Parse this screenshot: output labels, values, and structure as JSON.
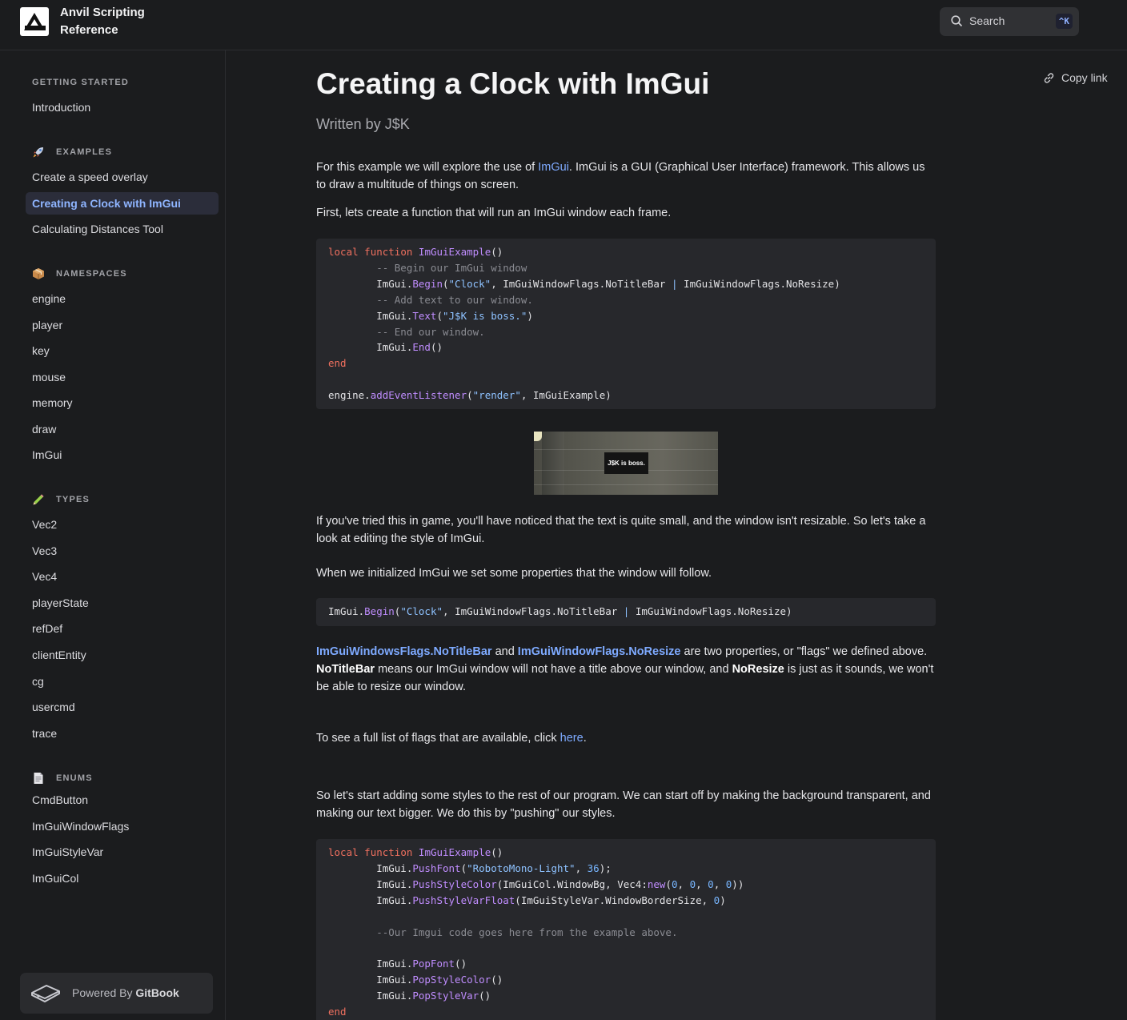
{
  "header": {
    "site_title": "Anvil Scripting Reference",
    "search_placeholder": "Search",
    "search_shortcut": "^K"
  },
  "sidebar": {
    "sections": [
      {
        "title": "GETTING STARTED",
        "icon": "",
        "items": [
          "Introduction"
        ]
      },
      {
        "title": "EXAMPLES",
        "icon": "rocket-icon",
        "items": [
          "Create a speed overlay",
          "Creating a Clock with ImGui",
          "Calculating Distances Tool"
        ]
      },
      {
        "title": "NAMESPACES",
        "icon": "package-icon",
        "items": [
          "engine",
          "player",
          "key",
          "mouse",
          "memory",
          "draw",
          "ImGui"
        ]
      },
      {
        "title": "TYPES",
        "icon": "pencil-icon",
        "items": [
          "Vec2",
          "Vec3",
          "Vec4",
          "playerState",
          "refDef",
          "clientEntity",
          "cg",
          "usercmd",
          "trace"
        ]
      },
      {
        "title": "ENUMS",
        "icon": "document-icon",
        "items": [
          "CmdButton",
          "ImGuiWindowFlags",
          "ImGuiStyleVar",
          "ImGuiCol"
        ]
      }
    ],
    "active_item": "Creating a Clock with ImGui",
    "powered_prefix": "Powered By",
    "powered_brand": "GitBook"
  },
  "page": {
    "title": "Creating a Clock with ImGui",
    "author": "Written by J$K",
    "copy_link": "Copy link",
    "p1_a": "For this example we will explore the use of ",
    "p1_link": "ImGui",
    "p1_b": ". ImGui is a GUI (Graphical User Interface) framework. This allows us to draw a multitude of things on screen.",
    "p2": "First, lets create a function that will run an ImGui window each frame.",
    "image_text": "J$K is boss.",
    "p3": "If you've tried this in game, you'll have noticed that the text is quite small, and the window isn't resizable. So let's take a look at editing the style of ImGui.",
    "p4": "When we initialized ImGui we set some properties that the window will follow.",
    "p5_link1": "ImGuiWindowsFlags.NoTitleBar",
    "p5_a": " and ",
    "p5_link2": "ImGuiWindowFlags.NoResize",
    "p5_b": " are two properties, or \"flags\" we defined above. ",
    "p5_bold1": "NoTitleBar",
    "p5_c": " means our ImGui window will not have a title above our window, and ",
    "p5_bold2": "NoResize",
    "p5_d": " is just as it sounds, we won't be able to resize our window.",
    "p6_a": "To see a full list of flags that are available, click ",
    "p6_link": "here",
    "p6_b": ".",
    "p7": "So let's start adding some styles to the rest of our program. We can start off by making the background transparent, and making our text bigger. We do this by \"pushing\" our styles."
  },
  "code_blocks": [
    {
      "lines": [
        "local function ImGuiExample()",
        "        -- Begin our ImGui window",
        "        ImGui.Begin(\"Clock\", ImGuiWindowFlags.NoTitleBar | ImGuiWindowFlags.NoResize)",
        "        -- Add text to our window.",
        "        ImGui.Text(\"J$K is boss.\")",
        "        -- End our window.",
        "        ImGui.End()",
        "end",
        "",
        "engine.addEventListener(\"render\", ImGuiExample)"
      ]
    },
    {
      "lines": [
        "ImGui.Begin(\"Clock\", ImGuiWindowFlags.NoTitleBar | ImGuiWindowFlags.NoResize)"
      ]
    },
    {
      "lines": [
        "local function ImGuiExample()",
        "        ImGui.PushFont(\"RobotoMono-Light\", 36);",
        "        ImGui.PushStyleColor(ImGuiCol.WindowBg, Vec4:new(0, 0, 0, 0))",
        "        ImGui.PushStyleVarFloat(ImGuiStyleVar.WindowBorderSize, 0)",
        "",
        "        --Our Imgui code goes here from the example above.",
        "",
        "        ImGui.PopFont()",
        "        ImGui.PopStyleColor()",
        "        ImGui.PopStyleVar()",
        "end"
      ]
    }
  ],
  "colors": {
    "background": "#1b1c1e",
    "accent": "#7eaaff",
    "code_bg": "#27282c",
    "keyword": "#f0705f",
    "function": "#c08dff",
    "string": "#8ec2ff",
    "comment": "#8a8b92"
  }
}
